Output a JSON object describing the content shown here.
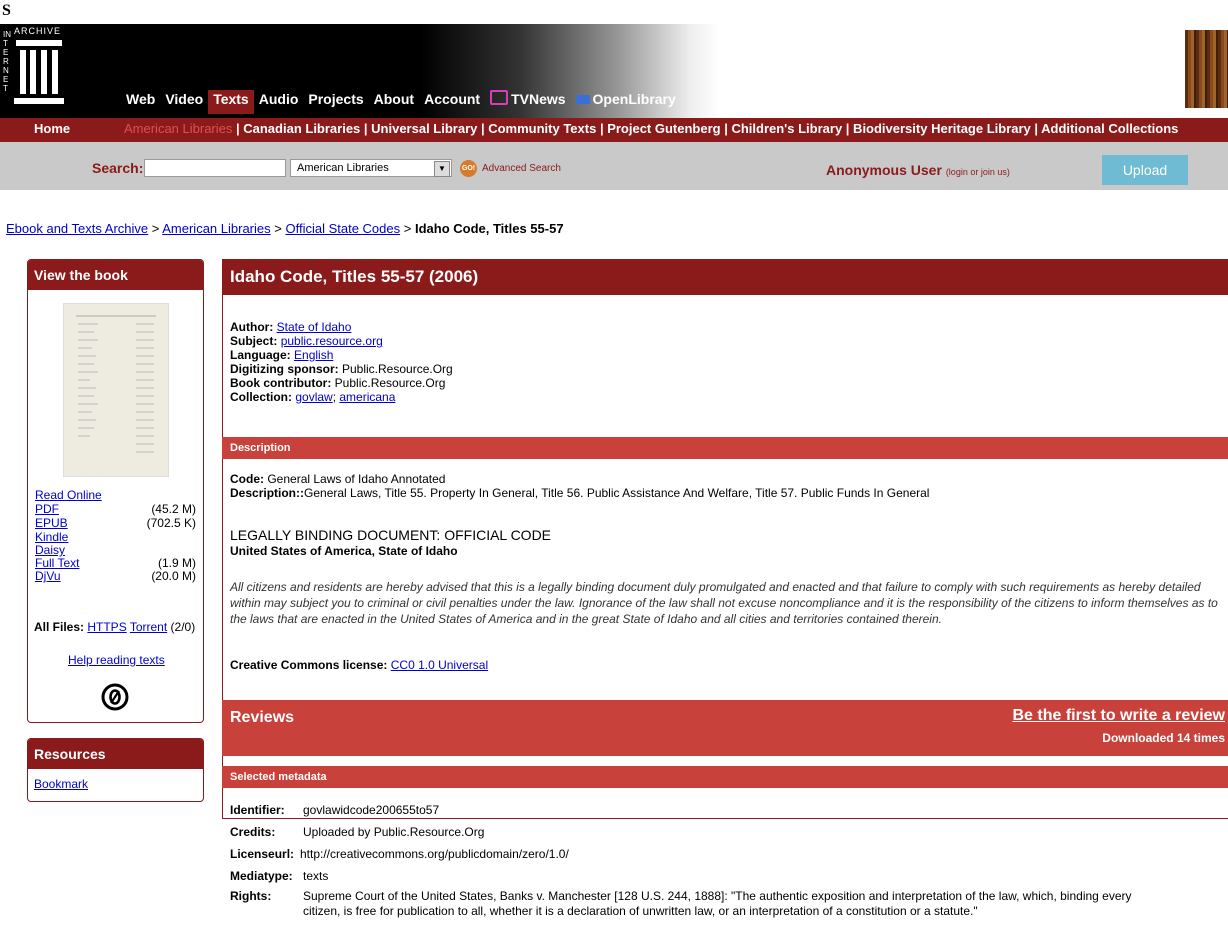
{
  "stray": "S",
  "logo": {
    "vertical": "INTERNET",
    "word": "ARCHIVE"
  },
  "nav": [
    {
      "label": "Web"
    },
    {
      "label": "Video"
    },
    {
      "label": "Texts"
    },
    {
      "label": "Audio"
    },
    {
      "label": "Projects"
    },
    {
      "label": "About"
    },
    {
      "label": "Account"
    },
    {
      "label": "TVNews"
    },
    {
      "label": "OpenLibrary"
    }
  ],
  "subnav": {
    "home": "Home",
    "current": "American Libraries",
    "links": "| Canadian Libraries | Universal Library | Community Texts | Project Gutenberg | Children's Library | Biodiversity Heritage Library | Additional Collections"
  },
  "search": {
    "label": "Search:",
    "value": "",
    "selected": "American Libraries",
    "go": "GO!",
    "advanced": "Advanced Search",
    "user": "Anonymous User",
    "login": "(login or join us)",
    "upload": "Upload"
  },
  "breadcrumb": {
    "root": "Ebook and Texts Archive",
    "sep": ">",
    "lib": "American Libraries",
    "coll": "Official State Codes",
    "current": "Idaho Code, Titles 55-57"
  },
  "viewbook": {
    "title": "View the book",
    "formats": [
      {
        "label": "Read Online",
        "size": ""
      },
      {
        "label": "PDF",
        "size": "(45.2 M)"
      },
      {
        "label": "EPUB",
        "size": "(702.5 K)"
      },
      {
        "label": "Kindle",
        "size": ""
      },
      {
        "label": "Daisy",
        "size": ""
      },
      {
        "label": "Full Text",
        "size": "(1.9 M)"
      },
      {
        "label": "DjVu",
        "size": "(20.0 M)"
      }
    ],
    "allfiles_label": "All Files:",
    "https": "HTTPS",
    "torrent": "Torrent",
    "torrent_count": "(2/0)",
    "help": "Help reading texts"
  },
  "resources": {
    "title": "Resources",
    "bookmark": "Bookmark"
  },
  "item": {
    "title": "Idaho Code, Titles 55-57 (2006)",
    "author_k": "Author:",
    "author_v": "State of Idaho",
    "subject_k": "Subject:",
    "subject_v": "public.resource.org",
    "language_k": "Language:",
    "language_v": "English",
    "sponsor_k": "Digitizing sponsor:",
    "sponsor_v": "Public.Resource.Org",
    "contrib_k": "Book contributor:",
    "contrib_v": "Public.Resource.Org",
    "collection_k": "Collection:",
    "collection_v1": "govlaw",
    "collection_v2": "americana"
  },
  "description": {
    "header": "Description",
    "code_k": "Code:",
    "code_v": "General Laws of Idaho Annotated",
    "desc_k": "Description::",
    "desc_v": "General Laws, Title 55. Property In General, Title 56. Public Assistance And Welfare, Title 57. Public Funds In General",
    "legal1": "LEGALLY BINDING DOCUMENT: OFFICIAL CODE",
    "legal2": "United States of America, State of Idaho",
    "notice": "All citizens and residents are hereby advised that this is a legally binding document duly promulgated and enacted and that failure to comply with such requirements as hereby detailed within may subject you to criminal or civil penalties under the law. Ignorance of the law shall not excuse noncompliance and it is the responsibility of the citizens to inform themselves as to the laws that are enacted in the United States of America and in the great State of Idaho and all cities and territories contained therein.",
    "cc_k": "Creative Commons license:",
    "cc_v": "CC0 1.0 Universal"
  },
  "reviews": {
    "title": "Reviews",
    "write": "Be the first to write a review",
    "downloaded": "Downloaded 14 times"
  },
  "metadata": {
    "header": "Selected metadata",
    "rows": [
      {
        "k": "Identifier:",
        "v": "govlawidcode200655to57"
      },
      {
        "k": "Credits:",
        "v": "Uploaded by Public.Resource.Org"
      },
      {
        "k": "Licenseurl:",
        "v": "http://creativecommons.org/publicdomain/zero/1.0/"
      },
      {
        "k": "Mediatype:",
        "v": "texts"
      },
      {
        "k": "Rights:",
        "v": "Supreme Court of the United States, Banks v. Manchester [128 U.S. 244, 1888]: \"The authentic exposition and interpretation of the law, which, binding every",
        "v2": "citizen, is free for publication to all, whether it is a declaration of unwritten law, or an interpretation of a constitution or a statute.\""
      }
    ]
  }
}
